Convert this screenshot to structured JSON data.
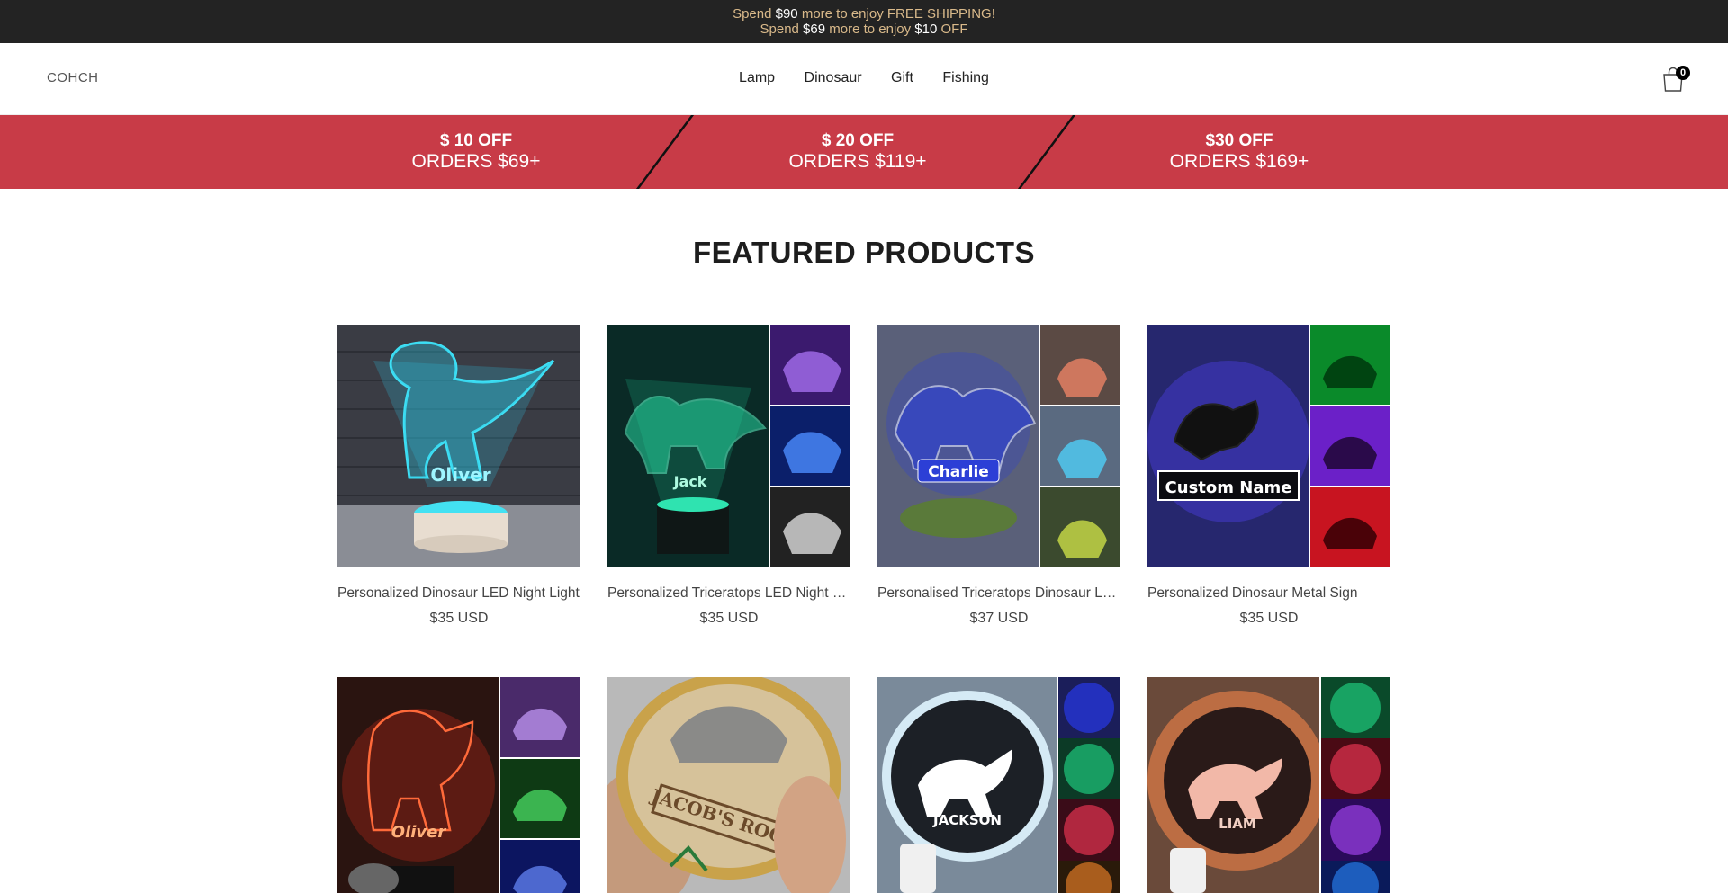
{
  "announcement": {
    "line1": {
      "pre": "Spend ",
      "amount": "$90",
      "post": " more to enjoy FREE SHIPPING!"
    },
    "line2": {
      "pre": "Spend ",
      "amount": "$69",
      "mid": " more to enjoy ",
      "amount2": "$10",
      "post": " OFF"
    }
  },
  "header": {
    "logo": "COHCH",
    "nav": [
      "Lamp",
      "Dinosaur",
      "Gift",
      "Fishing"
    ],
    "cart_count": "0"
  },
  "promo": [
    {
      "line1": "$ 10 OFF",
      "line2": "ORDERS $69+"
    },
    {
      "line1": "$ 20 OFF",
      "line2": "ORDERS $119+"
    },
    {
      "line1": "$30 OFF",
      "line2": "ORDERS $169+"
    }
  ],
  "featured": {
    "title": "FEATURED PRODUCTS",
    "products": [
      {
        "title": "Personalized Dinosaur LED Night Light",
        "price": "$35 USD",
        "image_label": "Oliver"
      },
      {
        "title": "Personalized Triceratops LED Night Light",
        "price": "$35 USD",
        "image_label": "Jack"
      },
      {
        "title": "Personalised Triceratops Dinosaur Lamp",
        "price": "$37 USD",
        "image_label": "Charlie"
      },
      {
        "title": "Personalized Dinosaur Metal Sign",
        "price": "$35 USD",
        "image_label": "Custom Name"
      },
      {
        "title": "",
        "price": "",
        "image_label": "Oliver"
      },
      {
        "title": "",
        "price": "",
        "image_label": "JACOB'S ROOM"
      },
      {
        "title": "",
        "price": "",
        "image_label": "JACKSON"
      },
      {
        "title": "",
        "price": "",
        "image_label": "LIAM"
      }
    ]
  },
  "colors": {
    "announce_bg": "#232323",
    "announce_text": "#d9b98a",
    "promo_bg": "#c83b47"
  }
}
